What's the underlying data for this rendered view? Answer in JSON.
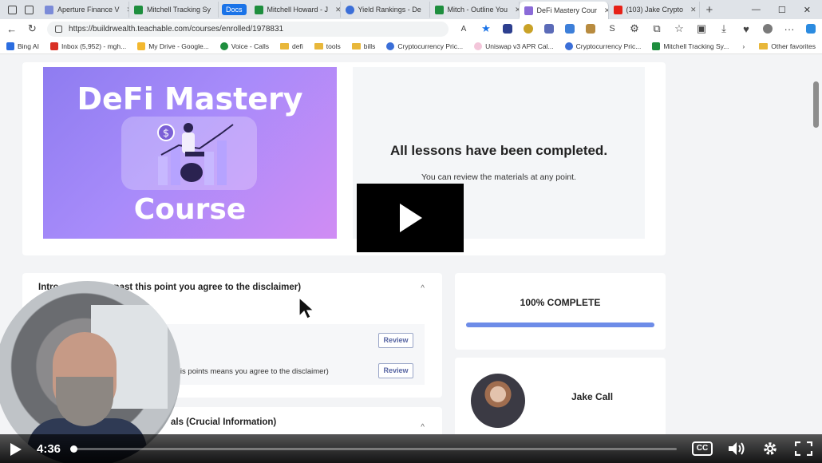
{
  "browser": {
    "tabs": [
      {
        "label": "Aperture Finance V",
        "color": "#7b8bd8"
      },
      {
        "label": "Mitchell Tracking Sy",
        "color": "#1e8e3e"
      },
      {
        "label": "Mitchell Howard - J",
        "color": "#1e8e3e"
      },
      {
        "label": "Yield Rankings - De",
        "color": "#3c6fd8"
      },
      {
        "label": "Mitch - Outline You",
        "color": "#1e8e3e"
      },
      {
        "label": "DeFi Mastery Cour",
        "color": "#8b6bd8"
      },
      {
        "label": "(103) Jake Crypto",
        "color": "#e62117"
      }
    ],
    "docs_chip": "Docs",
    "url": "https://buildrwealth.teachable.com/courses/enrolled/1978831",
    "bookmarks": [
      "Bing AI",
      "Inbox (5,952) - mgh...",
      "My Drive - Google...",
      "Voice - Calls",
      "defi",
      "tools",
      "bills",
      "Cryptocurrency Pric...",
      "Uniswap v3 APR Cal...",
      "Cryptocurrency Pric...",
      "Mitchell Tracking Sy..."
    ],
    "other_favorites": "Other favorites"
  },
  "course": {
    "image_title": "DeFi Mastery",
    "image_subtitle": "Course",
    "completed_heading": "All lessons have been completed.",
    "completed_text": "You can review the materials at any point."
  },
  "sections": [
    {
      "title": "Intro ... watching past this point you agree to the disclaimer)",
      "lessons": [
        {
          "text": "",
          "button": "Review"
        },
        {
          "text": "this points means you agree to the disclaimer)",
          "button": "Review"
        }
      ]
    },
    {
      "title": "als (Crucial Information)"
    }
  ],
  "progress": {
    "label": "100% COMPLETE",
    "fraction": 1.0
  },
  "author": {
    "name": "Jake Call"
  },
  "player": {
    "time": "4:36",
    "played_fraction": 0.0,
    "cc_label": "CC"
  },
  "colors": {
    "accent": "#6d8ce8",
    "play_bg": "#000000",
    "course_gradient_start": "#8e7cf0",
    "course_gradient_end": "#d08cf4"
  }
}
